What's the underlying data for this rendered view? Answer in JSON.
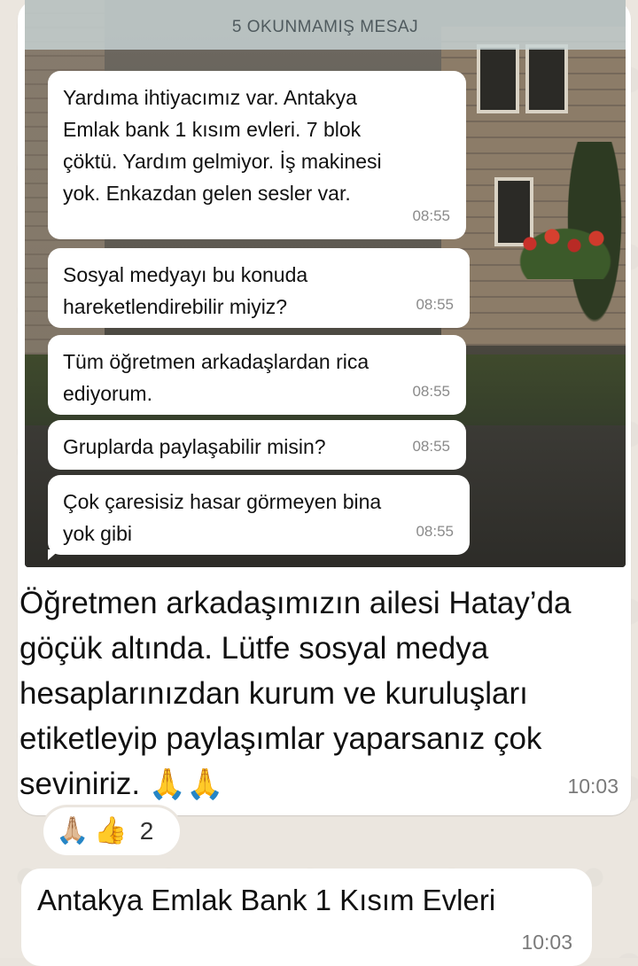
{
  "screenshot": {
    "unread_banner": "5 OKUNMAMIŞ MESAJ",
    "messages": [
      {
        "text": "Yardıma ihtiyacımız var. Antakya\nEmlak bank 1 kısım evleri. 7 blok\nçöktü. Yardım gelmiyor. İş makinesi\nyok. Enkazdan gelen sesler var.",
        "time": "08:55"
      },
      {
        "text": "Sosyal medyayı bu konuda\nhareketlendirebilir miyiz?",
        "time": "08:55"
      },
      {
        "text": "Tüm öğretmen arkadaşlardan rica\nediyorum.",
        "time": "08:55"
      },
      {
        "text": "Gruplarda paylaşabilir misin?",
        "time": "08:55"
      },
      {
        "text": "Çok çaresisiz hasar görmeyen bina\nyok gibi",
        "time": "08:55"
      }
    ]
  },
  "caption": {
    "text": "Öğretmen arkadaşımızın ailesi Hatay’da göçük altında. Lütfe sosyal medya hesaplarınızdan kurum ve kuruluşları etiketleyip paylaşımlar yaparsanız çok seviniriz.",
    "emoji": "🙏🙏",
    "time": "10:03"
  },
  "reactions": {
    "emoji_1": "🙏🏼",
    "emoji_2": "👍",
    "count": "2"
  },
  "second_message": {
    "text": "Antakya Emlak Bank 1 Kısım Evleri",
    "time": "10:03"
  }
}
